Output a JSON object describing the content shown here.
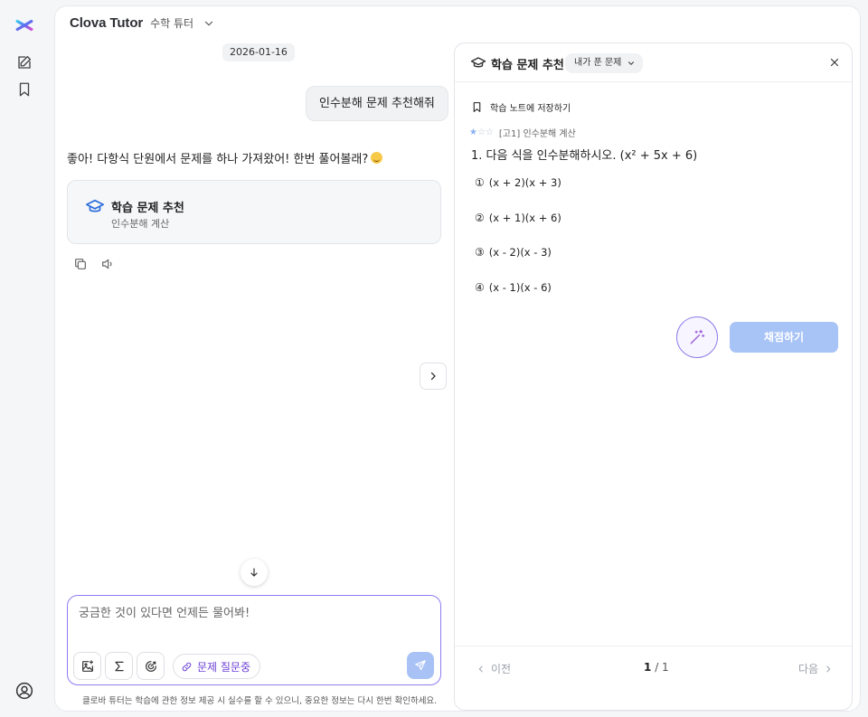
{
  "app": {
    "brand": "Clova Tutor",
    "mode": "수학 튜터"
  },
  "rail": {
    "icons": [
      "logo-asterisk-icon",
      "edit-icon",
      "bookmark-icon",
      "user-circle-icon"
    ]
  },
  "chat": {
    "date": "2026-01-16",
    "user_message": "인수분해 문제 추천해줘",
    "bot_message": "좋아! 다항식 단원에서 문제를 하나 가져왔어! 한번 풀어볼래?",
    "card": {
      "title": "학습 문제 추천",
      "subtitle": "인수분해 계산"
    }
  },
  "composer": {
    "placeholder": "궁금한 것이 있다면 언제든 물어봐!",
    "question_chip": "문제 질문중",
    "disclaimer": "클로바 튜터는 학습에 관한 정보 제공 시 실수를 할 수 있으니, 중요한 정보는 다시 한번 확인하세요."
  },
  "panel": {
    "title": "학습 문제 추천",
    "filter": "내가 푼 문제",
    "save_note": "학습 노트에 저장하기",
    "difficulty_stars": 1,
    "difficulty_max": 3,
    "tag": "[고1] 인수분해 계산",
    "question": "1. 다음 식을 인수분해하시오. (x² + 5x + 6)",
    "choices": [
      {
        "num": "①",
        "text": "(x + 2)(x + 3)"
      },
      {
        "num": "②",
        "text": "(x + 1)(x + 6)"
      },
      {
        "num": "③",
        "text": "(x - 2)(x - 3)"
      },
      {
        "num": "④",
        "text": "(x - 1)(x - 6)"
      }
    ],
    "grade_button": "채점하기",
    "prev_label": "이전",
    "next_label": "다음",
    "page_current": "1",
    "page_total": "/ 1"
  },
  "colors": {
    "accent": "#2f6fdc",
    "composer_border": "#8b7cf0",
    "button_disabled": "#a8c3f6",
    "chip_text": "#6b3fd6"
  }
}
